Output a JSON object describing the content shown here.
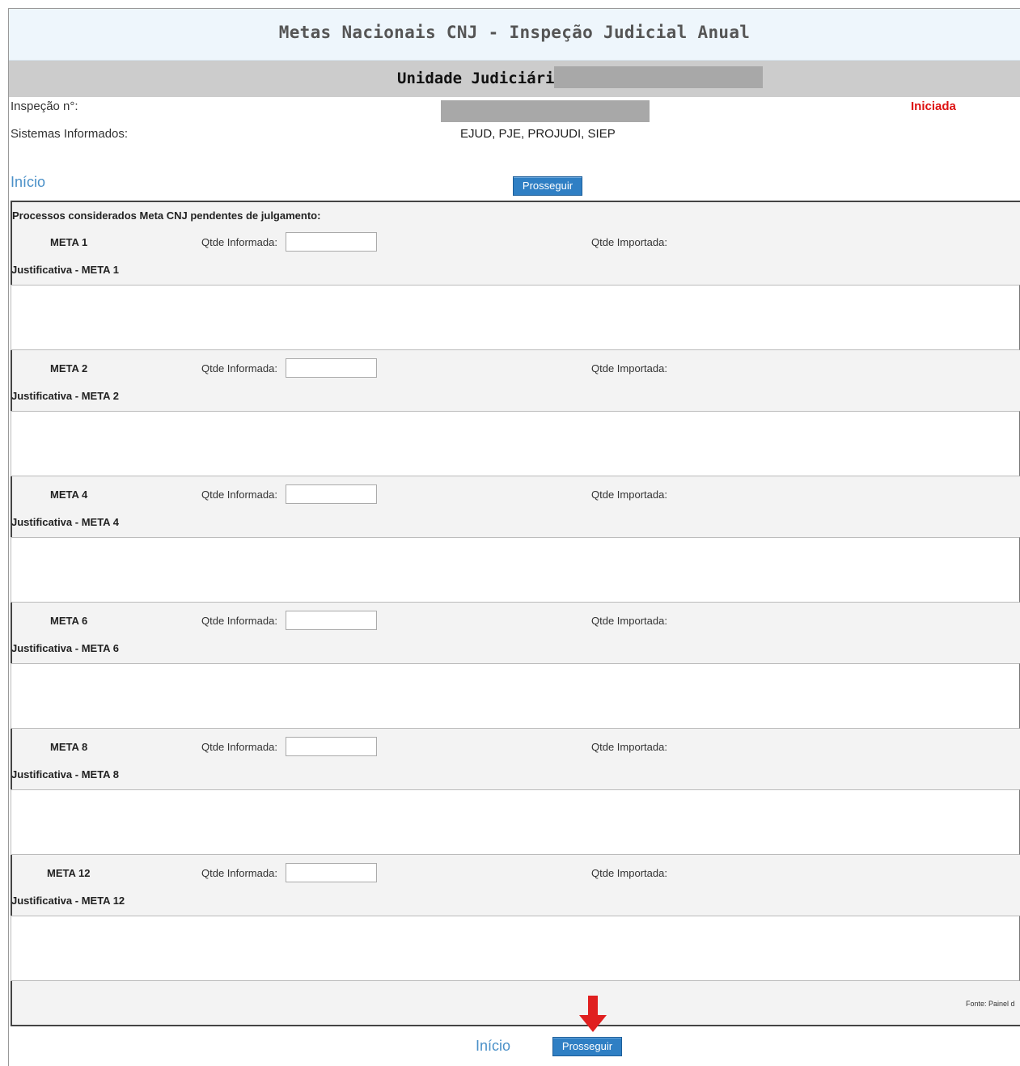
{
  "header": {
    "title": "Metas Nacionais CNJ - Inspeção Judicial Anual",
    "unit_label": "Unidade Judiciária:"
  },
  "info": {
    "inspection_label": "Inspeção n°:",
    "status": "Iniciada",
    "systems_label": "Sistemas Informados:",
    "systems_value": "EJUD, PJE, PROJUDI, SIEP"
  },
  "nav": {
    "home_link": "Início",
    "proceed_button": "Prosseguir"
  },
  "form": {
    "section_title": "Processos considerados Meta CNJ pendentes de julgamento:",
    "qtd_informada_label": "Qtde Informada:",
    "qtd_importada_label": "Qtde Importada:",
    "metas": [
      {
        "label": "META 1",
        "just_label": "Justificativa - META 1"
      },
      {
        "label": "META 2",
        "just_label": "Justificativa - META 2"
      },
      {
        "label": "META 4",
        "just_label": "Justificativa - META 4"
      },
      {
        "label": "META 6",
        "just_label": "Justificativa - META 6"
      },
      {
        "label": "META 8",
        "just_label": "Justificativa - META 8"
      },
      {
        "label": "META 12",
        "just_label": "Justificativa - META 12"
      }
    ],
    "source_note": "Fonte: Painel d"
  },
  "colors": {
    "accent_button": "#2f7fc4",
    "status_red": "#dd1111",
    "link_blue": "#4a90c8",
    "arrow_red": "#e02020"
  },
  "icons": {
    "pointer_arrow": "down-arrow-icon"
  }
}
